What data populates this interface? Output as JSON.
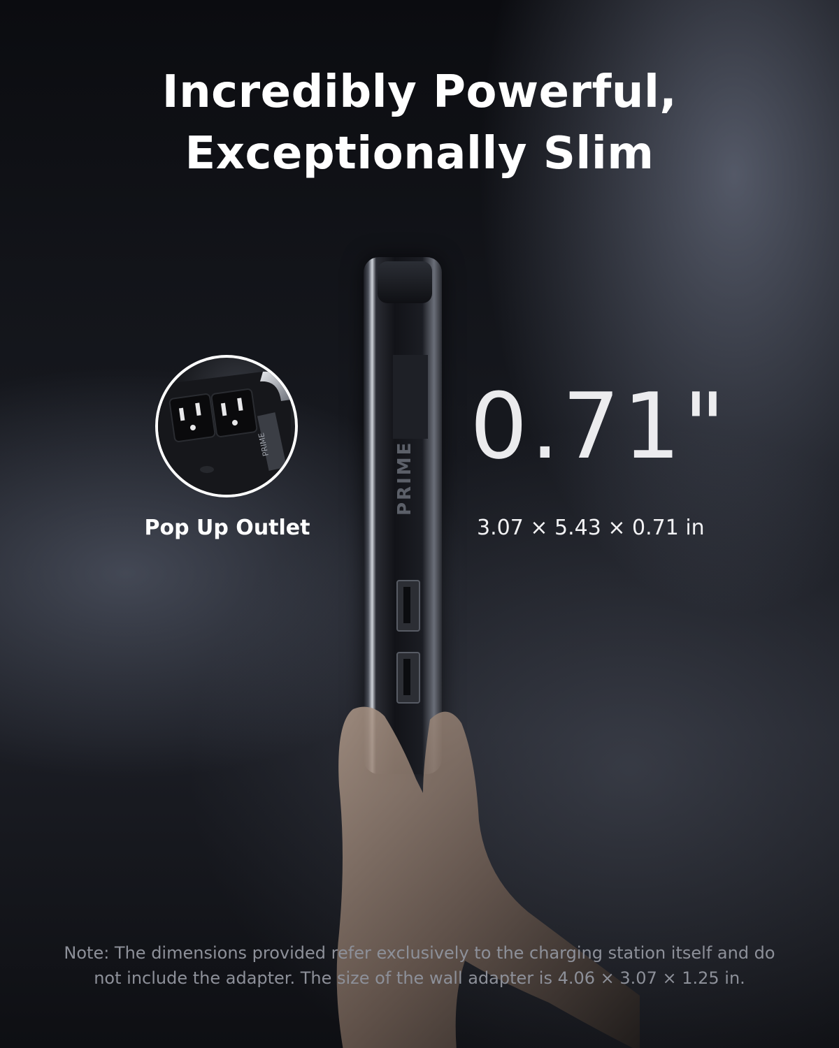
{
  "headline": {
    "line1": "Incredibly Powerful,",
    "line2": "Exceptionally Slim"
  },
  "feature": {
    "label": "Pop Up Outlet"
  },
  "device": {
    "brand_mark": "PRIME"
  },
  "measurement": {
    "thickness": "0.71\"",
    "dimensions": "3.07 × 5.43 × 0.71 in"
  },
  "note": {
    "line1": "Note: The dimensions provided refer exclusively to the charging station itself and do",
    "line2": "not include the adapter. The size of the wall adapter is 4.06 × 3.07 × 1.25 in."
  }
}
